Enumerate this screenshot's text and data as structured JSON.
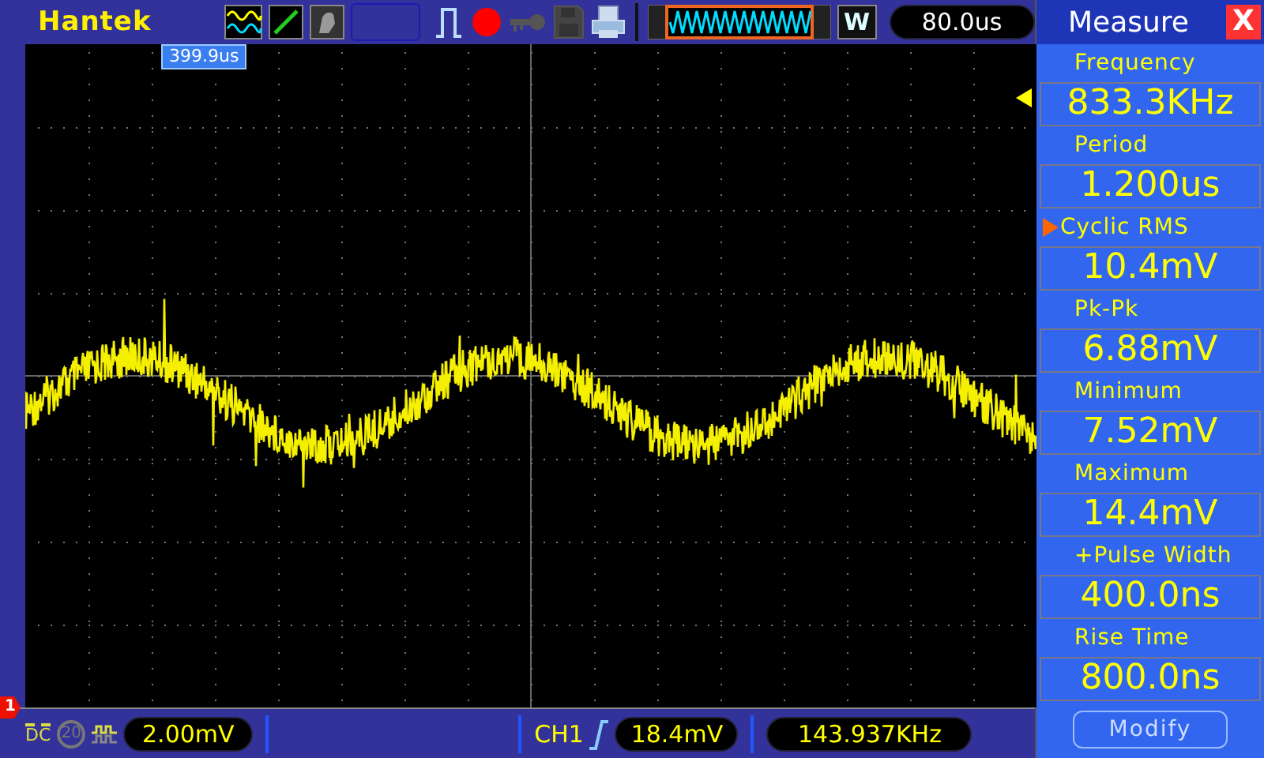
{
  "brand": "Hantek",
  "cursor_marker": "399.9us",
  "waveform_mode": "W",
  "timebase": "80.0us",
  "measure": {
    "title": "Measure",
    "close": "X",
    "items": [
      {
        "label": "Frequency",
        "value": "833.3KHz",
        "selected": false
      },
      {
        "label": "Period",
        "value": "1.200us",
        "selected": false
      },
      {
        "label": "Cyclic RMS",
        "value": "10.4mV",
        "selected": true
      },
      {
        "label": "Pk-Pk",
        "value": "6.88mV",
        "selected": false
      },
      {
        "label": "Minimum",
        "value": "7.52mV",
        "selected": false
      },
      {
        "label": "Maximum",
        "value": "14.4mV",
        "selected": false
      },
      {
        "label": "+Pulse Width",
        "value": "400.0ns",
        "selected": false
      },
      {
        "label": "Rise Time",
        "value": "800.0ns",
        "selected": false
      }
    ],
    "button": "Modify"
  },
  "channel_marker": "1",
  "bottom": {
    "coupling": "DC",
    "bw_limit": "20",
    "volts_div": "2.00mV",
    "trigger_source": "CH1",
    "trigger_level": "18.4mV",
    "frequency": "143.937KHz"
  }
}
